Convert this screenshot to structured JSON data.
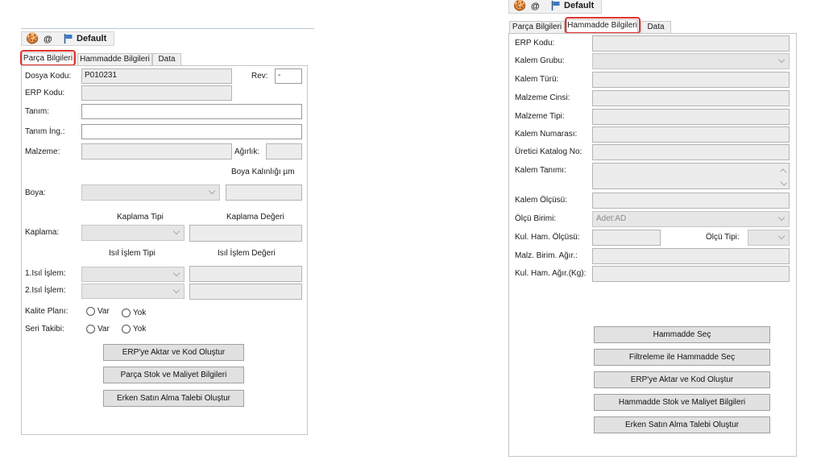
{
  "left": {
    "toolbar": {
      "at_label": "@",
      "profile_label": "Default"
    },
    "tabs": [
      "Parça Bilgileri",
      "Hammadde Bilgileri",
      "Data"
    ],
    "labels": {
      "dosya_kodu": "Dosya Kodu:",
      "rev": "Rev:",
      "erp_kodu": "ERP Kodu:",
      "tanim": "Tanım:",
      "tanim_ing": "Tanım İng.:",
      "malzeme": "Malzeme:",
      "agirlik": "Ağırlık:",
      "boya_kalinligi": "Boya Kalınlığı µm",
      "boya": "Boya:",
      "kaplama_tipi": "Kaplama Tipi",
      "kaplama_degeri": "Kaplama Değeri",
      "kaplama": "Kaplama:",
      "isil_islem_tipi": "Isıl İşlem Tipi",
      "isil_islem_degeri": "Isıl İşlem Değeri",
      "isil_islem_1": "1.Isıl İşlem:",
      "isil_islem_2": "2.Isıl İşlem:",
      "kalite_plani": "Kalite Planı:",
      "seri_takibi": "Seri Takibi:",
      "var": "Var",
      "yok": "Yok"
    },
    "values": {
      "dosya_kodu": "P010231",
      "rev": "-"
    },
    "buttons": [
      "ERP'ye Aktar ve Kod Oluştur",
      "Parça Stok ve Maliyet Bilgileri",
      "Erken Satın Alma Talebi Oluştur"
    ]
  },
  "right": {
    "toolbar": {
      "at_label": "@",
      "profile_label": "Default"
    },
    "tabs": [
      "Parça Bilgileri",
      "Hammadde Bilgileri",
      "Data"
    ],
    "labels": {
      "erp_kodu": "ERP Kodu:",
      "kalem_grubu": "Kalem Grubu:",
      "kalem_turu": "Kalem Türü:",
      "malzeme_cinsi": "Malzeme Cinsi:",
      "malzeme_tipi": "Malzeme Tipi:",
      "kalem_numarasi": "Kalem Numarası:",
      "uretici_katalog_no": "Üretici Katalog No:",
      "kalem_tanimi": "Kalem Tanımı:",
      "kalem_olcusu": "Kalem Ölçüsü:",
      "olcu_birimi": "Ölçü Birimi:",
      "kul_ham_olcusu": "Kul. Ham. Ölçüsü:",
      "olcu_tipi": "Ölçü Tipi:",
      "malz_birim_agir": "Malz. Birim. Ağır.:",
      "kul_ham_agir": "Kul. Ham. Ağır.(Kg):"
    },
    "values": {
      "olcu_birimi": "Adet:AD"
    },
    "buttons": [
      "Hammadde Seç",
      "Filtreleme ile Hammadde Seç",
      "ERP'ye Aktar ve Kod Oluştur",
      "Hammadde Stok ve Maliyet Bilgileri",
      "Erken Satın Alma Talebi Oluştur"
    ]
  },
  "colors": {
    "highlight": "#e0332e",
    "button_bg": "#e1e1e1",
    "readonly_bg": "#ececec"
  },
  "icons": [
    "sticker-icon",
    "at-icon",
    "flag-icon"
  ]
}
